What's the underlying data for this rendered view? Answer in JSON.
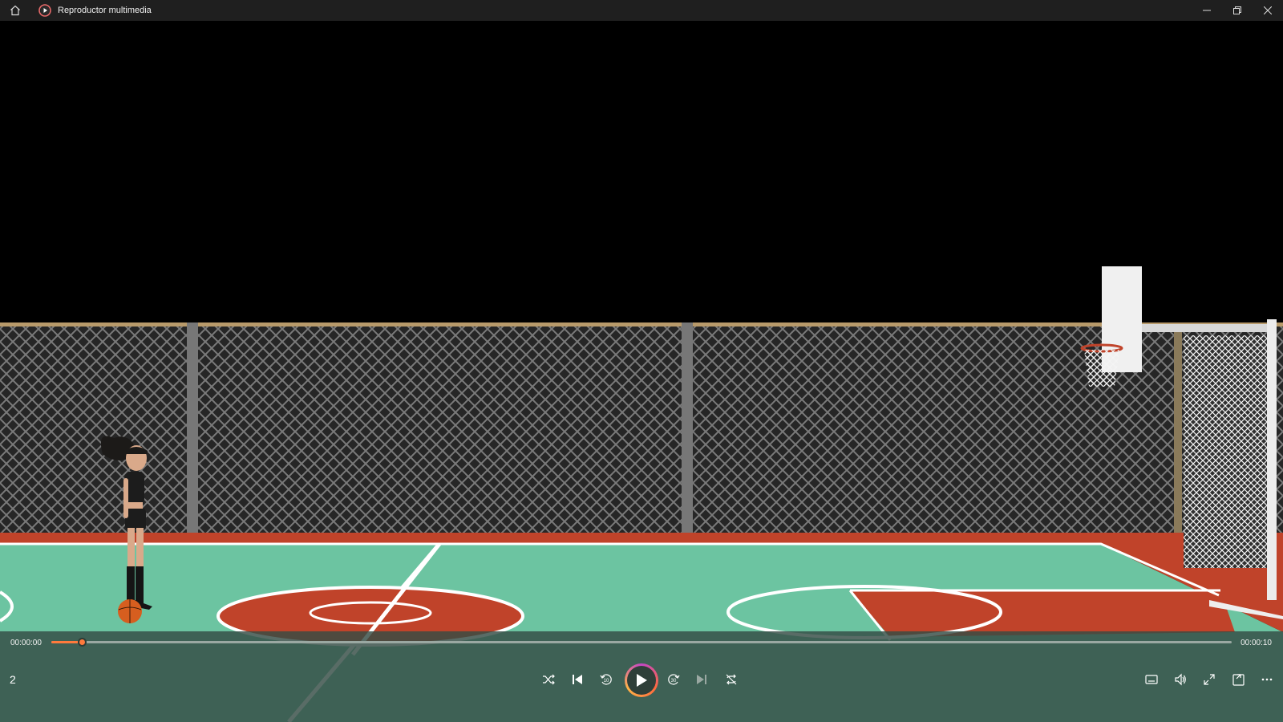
{
  "window": {
    "title": "Reproductor multimedia",
    "icons": {
      "home": "home-icon",
      "app": "media-player-icon",
      "minimize": "minimize-icon",
      "restore": "restore-icon",
      "close": "close-icon"
    }
  },
  "player": {
    "current_time": "00:00:00",
    "duration": "00:00:10",
    "progress": 0.026,
    "playlist_counter": "2",
    "accent": "#ff7a3c",
    "skip_back_label": "10",
    "skip_forward_label": "30",
    "buttons": [
      "shuffle-icon",
      "previous-icon",
      "skip-back-10-icon",
      "play-icon",
      "skip-forward-30-icon",
      "next-icon",
      "repeat-off-icon"
    ],
    "right_buttons": [
      "subtitles-icon",
      "volume-icon",
      "fullscreen-icon",
      "mini-player-icon",
      "more-icon"
    ]
  },
  "scene": {
    "court_green": "#6cc4a1",
    "court_red": "#c0432a",
    "fence": "#4a4a4a"
  }
}
